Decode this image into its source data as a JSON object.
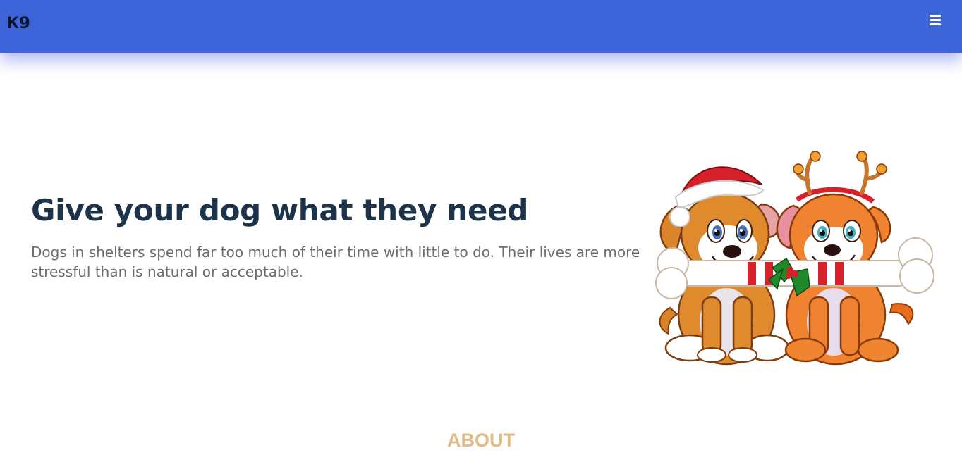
{
  "header": {
    "logo_text": "K9",
    "menu_icon": "hamburger-menu-icon",
    "background_color": "#3e64da"
  },
  "hero": {
    "title": "Give your dog what they need",
    "description": "Dogs in shelters spend far too much of their time with little to do. Their lives are more stressful than is natural or acceptable.",
    "illustration": "two-cartoon-puppies-holding-bone-christmas-illustration"
  },
  "about": {
    "heading": "ABOUT",
    "heading_color": "#e0bb83"
  },
  "colors": {
    "title": "#1c3349",
    "body_text": "#6c6c6c"
  }
}
